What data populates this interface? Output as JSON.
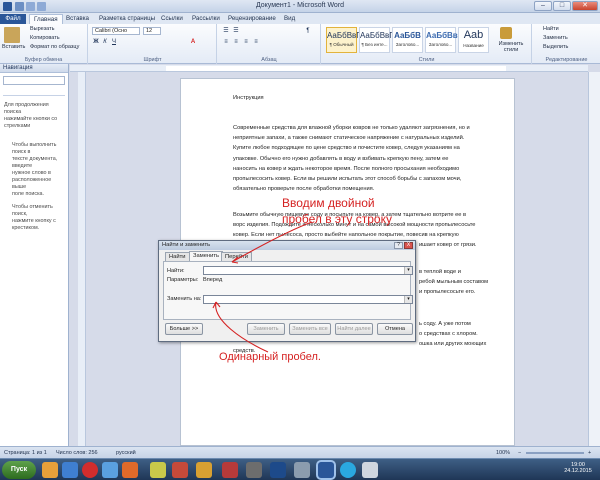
{
  "window": {
    "title": "Документ1 - Microsoft Word",
    "min": "–",
    "max": "□",
    "close": "✕"
  },
  "tabs": [
    "Файл",
    "Главная",
    "Вставка",
    "Разметка страницы",
    "Ссылки",
    "Рассылки",
    "Рецензирование",
    "Вид"
  ],
  "ribbon": {
    "clipboard": {
      "paste": "Вставить",
      "cut": "Вырезать",
      "copy": "Копировать",
      "format": "Формат по образцу",
      "label": "Буфер обмена"
    },
    "font": {
      "name": "Calibri (Осно",
      "size": "12",
      "label": "Шрифт"
    },
    "paragraph": {
      "label": "Абзац"
    },
    "styles": {
      "items": [
        {
          "preview": "АаБбВвГ",
          "name": "¶ Обычный"
        },
        {
          "preview": "АаБбВвГ",
          "name": "¶ Без инте..."
        },
        {
          "preview": "АаБбВ",
          "name": "Заголово..."
        },
        {
          "preview": "АаБбВв",
          "name": "Заголово..."
        },
        {
          "preview": "Aab",
          "name": "Название"
        }
      ],
      "change": "Изменить стили",
      "label": "Стили"
    },
    "editing": {
      "find": "Найти",
      "replace": "Заменить",
      "select": "Выделить",
      "label": "Редактирование"
    }
  },
  "nav": {
    "title": "Навигация",
    "hint": [
      "Для продолжения поиска",
      "нажимайте кнопки со стрелками"
    ],
    "help1": [
      "Чтобы выполнить поиск в",
      "тексте документа, введите",
      "нужное слово в",
      "расположенное выше",
      "поле поиска."
    ],
    "help2": [
      "Чтобы отменить поиск,",
      "нажмите кнопку с",
      "крестиком."
    ]
  },
  "document": {
    "title": "Инструкция",
    "lines1": [
      "Современные средства для влажной уборки ковров не только удаляют загрязнения, но и",
      "неприятные запахи, а также снимают статическое напряжение  с натуральных изделий.",
      "Купите любое  подходящее по цене средство и  почистите ковер, следуя указаниям на",
      "упаковке. Обычно его нужно добавлять в воду и взбивать крепкую пену, затем ее",
      "наносить на ковер и ждать некоторое  время. После полного просыхания   необходимо",
      "пропылесосить  ковер. Если вы решили испытать этот способ борьбы с запахом мочи,",
      "обязательно проверьте  после обработки  помещения."
    ],
    "lines2": [
      "Возьмите обычную пищевую соду и посыпьте на ковер, а затем тщательно вотрите ее в",
      "ворс изделия. Подождите  и несколько минут и на самой высокой мощности пропылесосьте",
      "ковер. Если нет пылесоса, просто выбейте напольное покрытие, повесив на крепкую"
    ],
    "frag1": "ишает ковер от грязи.",
    "frag2a": "в теплой  воде и",
    "frag2b": "ребой мыльным составом",
    "frag2c": "и пропылесосьте  его.",
    "frag3a": "ь соду. А уже потом",
    "frag3b": "о средствах с хлором.",
    "frag3c": "ошка или других моющих",
    "last": "средств."
  },
  "dialog": {
    "title": "Найти и заменить",
    "help": "?",
    "close": "X",
    "tabs": [
      "Найти",
      "Заменить",
      "Перейти"
    ],
    "find_label": "Найти:",
    "params_label": "Параметры:",
    "params_value": "Вперед",
    "replace_label": "Заменить на:",
    "more": "Больше >>",
    "replace": "Заменить",
    "replace_all": "Заменить все",
    "find_next": "Найти далее",
    "cancel": "Отмена"
  },
  "annotations": {
    "line1": "Вводим двойной",
    "line2": "пробел в эту строку",
    "single": "Одинарный пробел."
  },
  "status": {
    "page": "Страница: 1 из 1",
    "words": "Число слов: 256",
    "lang": "русский",
    "zoom": "100%",
    "zoom_minus": "−",
    "zoom_plus": "+"
  },
  "taskbar": {
    "start": "Пуск",
    "time": "19:00",
    "date": "24.12.2015"
  },
  "colors": {
    "file_tab": "#2a5699",
    "annotation": "#d52222"
  }
}
